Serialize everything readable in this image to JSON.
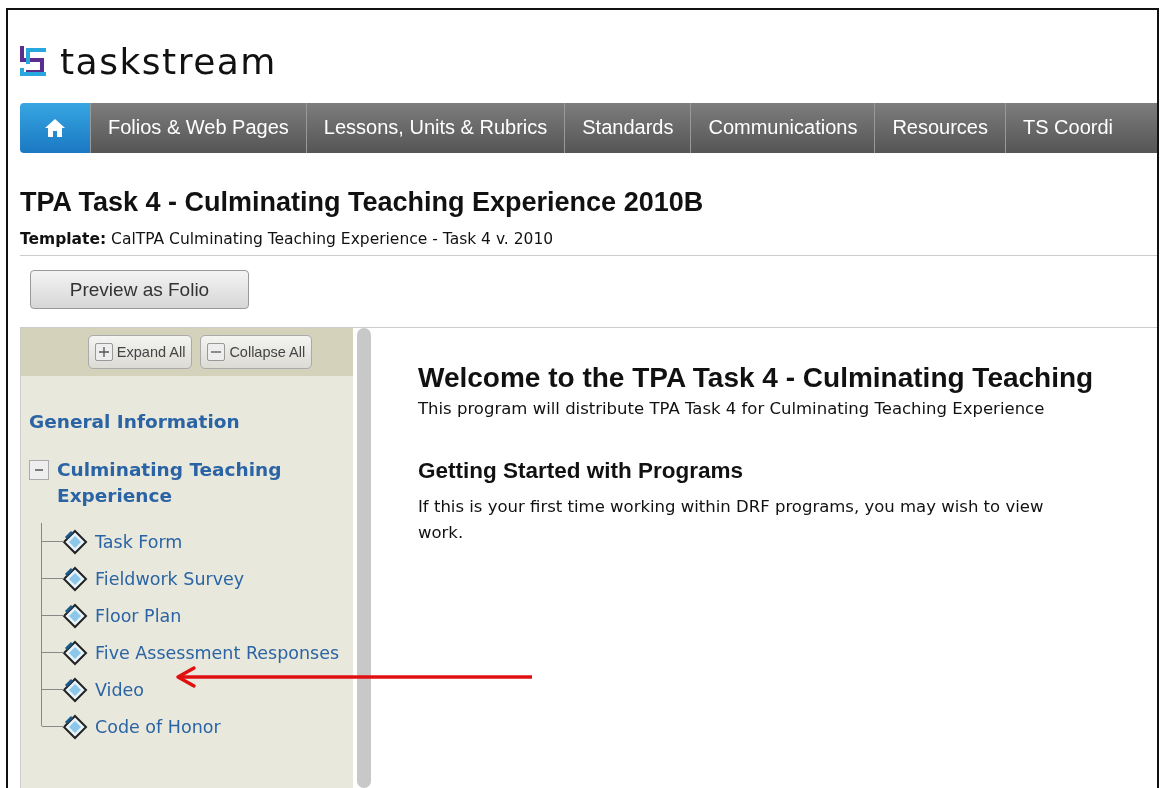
{
  "logo": {
    "text": "taskstream"
  },
  "nav": {
    "tabs": [
      {
        "kind": "home",
        "selected": true
      },
      {
        "label": "Folios & Web Pages",
        "kind": "text",
        "selected": false
      },
      {
        "label": "Lessons, Units & Rubrics",
        "kind": "text",
        "selected": false
      },
      {
        "label": "Standards",
        "kind": "text",
        "selected": false
      },
      {
        "label": "Communications",
        "kind": "text",
        "selected": false
      },
      {
        "label": "Resources",
        "kind": "text",
        "selected": false
      },
      {
        "label": "TS Coordi",
        "kind": "text",
        "selected": false
      }
    ]
  },
  "page": {
    "title": "TPA Task 4 - Culminating Teaching Experience 2010B",
    "template_label": "Template:",
    "template_value": "CalTPA Culminating Teaching Experience - Task 4 v. 2010",
    "preview_button": "Preview as Folio"
  },
  "sidebar": {
    "expand_all": "Expand All",
    "collapse_all": "Collapse All",
    "tree": [
      {
        "label": "General Information"
      },
      {
        "label": "Culminating Teaching Experience",
        "expanded": true,
        "children": [
          {
            "label": "Task Form"
          },
          {
            "label": "Fieldwork Survey"
          },
          {
            "label": "Floor Plan"
          },
          {
            "label": "Five Assessment Responses"
          },
          {
            "label": "Video"
          },
          {
            "label": "Code of Honor"
          }
        ]
      }
    ]
  },
  "content": {
    "heading": "Welcome to the TPA Task 4 - Culminating Teaching",
    "intro": "This program will distribute TPA Task 4 for Culminating Teaching Experience",
    "subheading": "Getting Started with Programs",
    "body_lines": [
      "If this is your first time working within DRF programs, you may wish to view",
      "work."
    ]
  },
  "annotation": {
    "kind": "arrow"
  }
}
